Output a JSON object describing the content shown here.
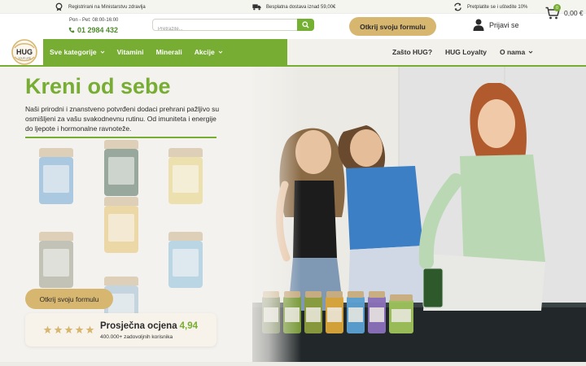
{
  "topbar": {
    "items": [
      {
        "icon": "award-icon",
        "text": "Registrirani na Ministarstvu zdravlja"
      },
      {
        "icon": "truck-icon",
        "text": "Besplatna dostava iznad 59,00€"
      },
      {
        "icon": "refresh-icon",
        "text": "Pretplatite se i uštedite 10%"
      }
    ]
  },
  "header": {
    "hours": "Pon - Pet: 08:00-16:00",
    "phone": "01 2984 432",
    "search_placeholder": "Pretražite...",
    "cta_label": "Otkrij svoju formulu",
    "login_label": "Prijavi se"
  },
  "logo": {
    "text_top": "HUG",
    "text_bottom": "YOUR LIFE"
  },
  "nav": {
    "left": [
      {
        "label": "Sve kategorije",
        "dropdown": true
      },
      {
        "label": "Vitamini",
        "dropdown": false
      },
      {
        "label": "Minerali",
        "dropdown": false
      },
      {
        "label": "Akcije",
        "dropdown": true
      }
    ],
    "right": [
      {
        "label": "Zašto HUG?",
        "dropdown": false
      },
      {
        "label": "HUG Loyalty",
        "dropdown": false
      },
      {
        "label": "O nama",
        "dropdown": true
      }
    ],
    "cart_count": "0",
    "cart_total": "0,00 €"
  },
  "hero": {
    "headline": "Kreni od sebe",
    "subtext": "Naši prirodni i znanstveno potvrđeni dodaci prehrani pažljivo su osmišljeni za vašu svakodnevnu rutinu. Od imuniteta i energije do ljepote i hormonalne ravnoteže.",
    "cta_label": "Otkrij svoju formulu",
    "rating_title": "Prosječna ocjena",
    "rating_value": "4,94",
    "stars": 5,
    "rating_sub": "400.000+ zadovoljnih korisnika"
  },
  "colors": {
    "brand_green": "#76ad32",
    "gold": "#d7b670",
    "nav_bg_right": "#f3f1ec"
  }
}
